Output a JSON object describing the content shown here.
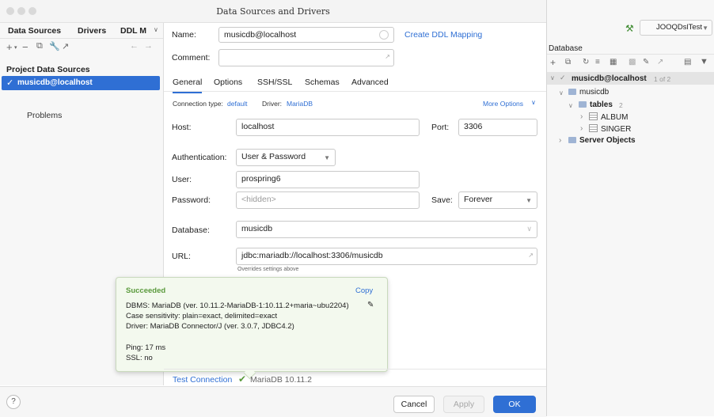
{
  "window": {
    "title": "Data Sources and Drivers"
  },
  "left": {
    "tabs": [
      "Data Sources",
      "Drivers",
      "DDL M"
    ],
    "section": "Project Data Sources",
    "selected": "musicdb@localhost",
    "problems": "Problems"
  },
  "form": {
    "name_label": "Name:",
    "name_value": "musicdb@localhost",
    "ddl_link": "Create DDL Mapping",
    "comment_label": "Comment:",
    "tabs": [
      "General",
      "Options",
      "SSH/SSL",
      "Schemas",
      "Advanced"
    ],
    "conn_type_label": "Connection type:",
    "conn_type_value": "default",
    "driver_label": "Driver:",
    "driver_value": "MariaDB",
    "more_options": "More Options",
    "host_label": "Host:",
    "host_value": "localhost",
    "port_label": "Port:",
    "port_value": "3306",
    "auth_label": "Authentication:",
    "auth_value": "User & Password",
    "user_label": "User:",
    "user_value": "prospring6",
    "password_label": "Password:",
    "password_placeholder": "<hidden>",
    "save_label": "Save:",
    "save_value": "Forever",
    "database_label": "Database:",
    "database_value": "musicdb",
    "url_label": "URL:",
    "url_value": "jdbc:mariadb://localhost:3306/musicdb",
    "url_hint": "Overrides settings above"
  },
  "popup": {
    "title": "Succeeded",
    "copy": "Copy",
    "line1": "DBMS: MariaDB (ver. 10.11.2-MariaDB-1:10.11.2+maria~ubu2204)",
    "line2": "Case sensitivity: plain=exact, delimited=exact",
    "line3": "Driver: MariaDB Connector/J (ver. 3.0.7, JDBC4.2)",
    "line4": "Ping: 17 ms",
    "line5": "SSL: no"
  },
  "footer": {
    "test_connection": "Test Connection",
    "db_version": "MariaDB 10.11.2",
    "help": "?",
    "cancel": "Cancel",
    "apply": "Apply",
    "ok": "OK"
  },
  "right": {
    "run_config": "JOOQDslTest",
    "panel_title": "Database",
    "tree": {
      "root": "musicdb@localhost",
      "root_count": "1 of 2",
      "schema": "musicdb",
      "tables": "tables",
      "tables_count": "2",
      "table1": "ALBUM",
      "table2": "SINGER",
      "server_objects": "Server Objects"
    }
  },
  "colors": {
    "accent": "#2f6fd4",
    "success_bg": "#f3f9ee",
    "success_text": "#5a9a3c"
  }
}
